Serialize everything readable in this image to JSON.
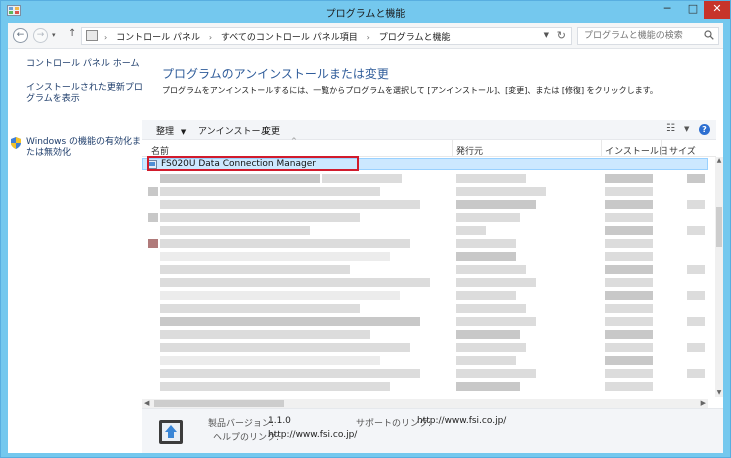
{
  "window": {
    "title": "プログラムと機能",
    "minimize": "─",
    "maximize": "□",
    "close": "✕"
  },
  "nav": {
    "back_icon": "back-arrow-icon",
    "forward_icon": "forward-arrow-icon",
    "up_icon": "up-arrow-icon"
  },
  "address": {
    "crumbs": [
      "コントロール パネル",
      "すべてのコントロール パネル項目",
      "プログラムと機能"
    ]
  },
  "search": {
    "placeholder": "プログラムと機能の検索"
  },
  "sidebar": {
    "items": [
      {
        "label": "コントロール パネル ホーム"
      },
      {
        "label": "インストールされた更新プログラムを表示"
      },
      {
        "label": "Windows の機能の有効化または無効化"
      }
    ]
  },
  "main": {
    "title": "プログラムのアンインストールまたは変更",
    "description": "プログラムをアンインストールするには、一覧からプログラムを選択して [アンインストール]、[変更]、または [修復] をクリックします。"
  },
  "toolbar": {
    "organize": "整理",
    "uninstall": "アンインストール",
    "change": "変更"
  },
  "columns": {
    "name": "名前",
    "publisher": "発行元",
    "installed_on": "インストール日",
    "size": "サイズ"
  },
  "list": {
    "selected_item": "FS020U Data Connection Manager"
  },
  "details": {
    "version_label": "製品バージョン:",
    "version_value": "1.1.0",
    "support_label": "サポートのリンク:",
    "support_value": "http://www.fsi.co.jp/",
    "help_label": "ヘルプのリンク:",
    "help_value": "http://www.fsi.co.jp/"
  },
  "colors": {
    "accent": "#2f5c9a",
    "selection": "#cce8ff",
    "highlight_border": "#d11b2c",
    "frame": "#74c8ee"
  }
}
